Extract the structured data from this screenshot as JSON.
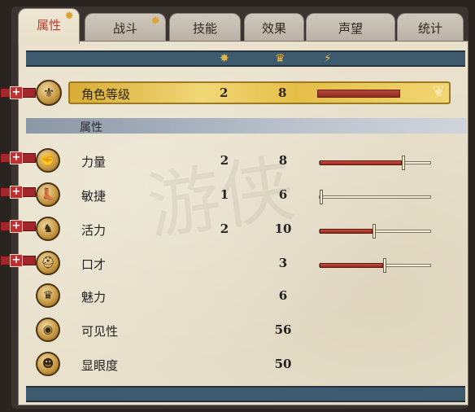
{
  "tabs": [
    {
      "label": "属性",
      "active": true,
      "starred": true
    },
    {
      "label": "战斗",
      "active": false,
      "starred": true
    },
    {
      "label": "技能",
      "active": false,
      "starred": false
    },
    {
      "label": "效果",
      "active": false,
      "starred": false
    },
    {
      "label": "声望",
      "active": false,
      "starred": false
    },
    {
      "label": "统计",
      "active": false,
      "starred": false
    }
  ],
  "header_icons": [
    "sun-icon",
    "crown-icon",
    "lightning-badge-icon"
  ],
  "level": {
    "label": "角色等级",
    "value": "2",
    "max": "8",
    "fraction": 0.25,
    "medal_icon": "fleur-de-lis-icon"
  },
  "section": {
    "label": "属性"
  },
  "attributes": [
    {
      "label": "力量",
      "value": "2",
      "max": "8",
      "fraction": 0.78,
      "has_plus": true,
      "has_bar": true,
      "icon": "fist-icon"
    },
    {
      "label": "敏捷",
      "value": "1",
      "max": "6",
      "fraction": 0.0,
      "has_plus": true,
      "has_bar": true,
      "icon": "boot-icon"
    },
    {
      "label": "活力",
      "value": "2",
      "max": "10",
      "fraction": 0.5,
      "has_plus": true,
      "has_bar": true,
      "icon": "horse-head-icon"
    },
    {
      "label": "口才",
      "value": "",
      "max": "3",
      "fraction": 0.6,
      "has_plus": true,
      "has_bar": true,
      "icon": "helmet-icon"
    },
    {
      "label": "魅力",
      "value": "",
      "max": "6",
      "has_plus": false,
      "has_bar": false,
      "icon": "crown-icon"
    },
    {
      "label": "可见性",
      "value": "",
      "max": "56",
      "has_plus": false,
      "has_bar": false,
      "icon": "eye-icon"
    },
    {
      "label": "显眼度",
      "value": "",
      "max": "50",
      "has_plus": false,
      "has_bar": false,
      "icon": "head-profile-icon"
    }
  ],
  "colors": {
    "active_tab_text": "#c0382b",
    "band": "#3e5a6e",
    "bar_red": "#b54838",
    "gold": "#e5be48"
  }
}
